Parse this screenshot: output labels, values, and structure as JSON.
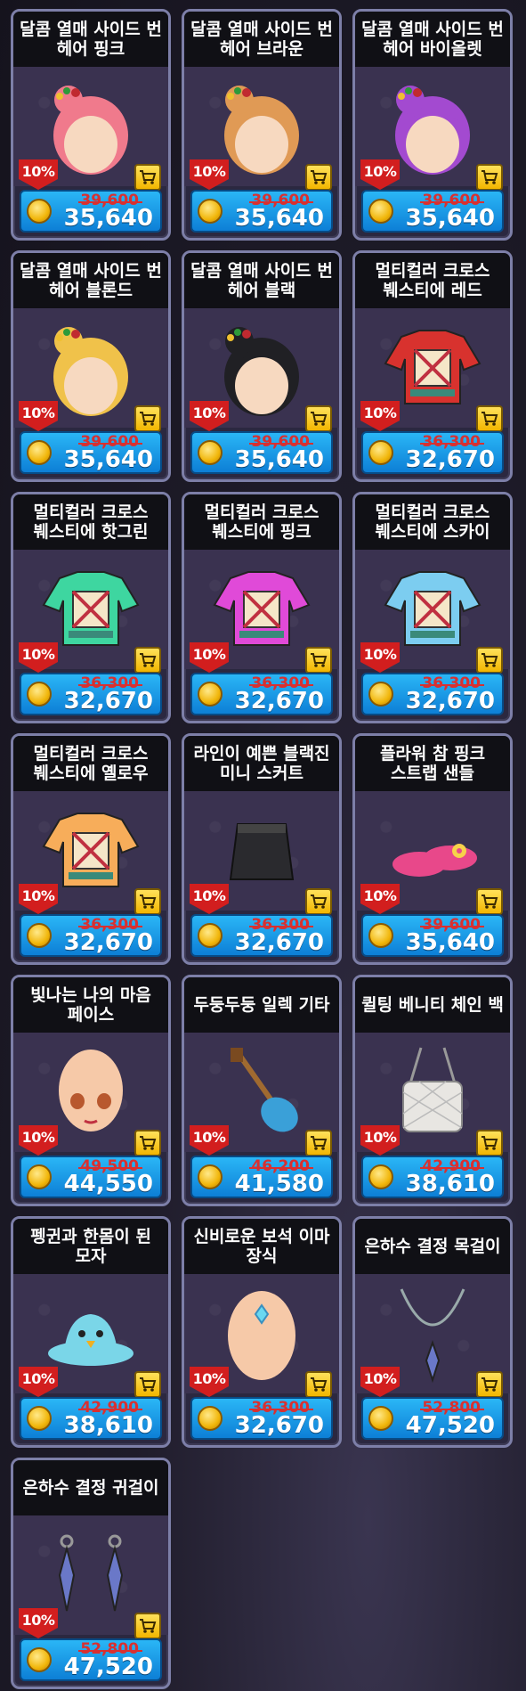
{
  "items": [
    {
      "name": "달콤 열매 사이드 번\n헤어 핑크",
      "discount": "10%",
      "old_price": "39,600",
      "price": "35,640",
      "icon": "hair-icon",
      "color": "#f07a8c"
    },
    {
      "name": "달콤 열매 사이드 번\n헤어 브라운",
      "discount": "10%",
      "old_price": "39,600",
      "price": "35,640",
      "icon": "hair-icon",
      "color": "#e09a55"
    },
    {
      "name": "달콤 열매 사이드 번\n헤어 바이올렛",
      "discount": "10%",
      "old_price": "39,600",
      "price": "35,640",
      "icon": "hair-icon",
      "color": "#a34ad0"
    },
    {
      "name": "달콤 열매 사이드 번\n헤어 블론드",
      "discount": "10%",
      "old_price": "39,600",
      "price": "35,640",
      "icon": "hair-icon",
      "color": "#f0c24a"
    },
    {
      "name": "달콤 열매 사이드 번\n헤어 블랙",
      "discount": "10%",
      "old_price": "39,600",
      "price": "35,640",
      "icon": "hair-icon",
      "color": "#202024"
    },
    {
      "name": "멀티컬러 크로스\n붸스티에 레드",
      "discount": "10%",
      "old_price": "36,300",
      "price": "32,670",
      "icon": "shirt-icon",
      "color": "#d8322e"
    },
    {
      "name": "멀티컬러 크로스\n붸스티에 핫그린",
      "discount": "10%",
      "old_price": "36,300",
      "price": "32,670",
      "icon": "shirt-icon",
      "color": "#3ed6a0"
    },
    {
      "name": "멀티컬러 크로스\n붸스티에 핑크",
      "discount": "10%",
      "old_price": "36,300",
      "price": "32,670",
      "icon": "shirt-icon",
      "color": "#e04ad8"
    },
    {
      "name": "멀티컬러 크로스\n붸스티에 스카이",
      "discount": "10%",
      "old_price": "36,300",
      "price": "32,670",
      "icon": "shirt-icon",
      "color": "#7ccdf0"
    },
    {
      "name": "멀티컬러 크로스\n붸스티에 옐로우",
      "discount": "10%",
      "old_price": "36,300",
      "price": "32,670",
      "icon": "shirt-icon",
      "color": "#f7ad5a"
    },
    {
      "name": "라인이 예쁜 블랙진\n미니 스커트",
      "discount": "10%",
      "old_price": "36,300",
      "price": "32,670",
      "icon": "skirt-icon",
      "color": "#2a2a2e"
    },
    {
      "name": "플라워 참 핑크\n스트랩 샌들",
      "discount": "10%",
      "old_price": "39,600",
      "price": "35,640",
      "icon": "sandal-icon",
      "color": "#e8488a"
    },
    {
      "name": "빛나는 나의 마음\n페이스",
      "discount": "10%",
      "old_price": "49,500",
      "price": "44,550",
      "icon": "face-icon",
      "color": "#f6c9a8"
    },
    {
      "name": "두둥두둥 일렉 기타",
      "discount": "10%",
      "old_price": "46,200",
      "price": "41,580",
      "icon": "guitar-icon",
      "color": "#3aa0d8"
    },
    {
      "name": "퀼팅 베니티 체인 백",
      "discount": "10%",
      "old_price": "42,900",
      "price": "38,610",
      "icon": "bag-icon",
      "color": "#e8e6e2"
    },
    {
      "name": "펭귄과 한몸이 된\n모자",
      "discount": "10%",
      "old_price": "42,900",
      "price": "38,610",
      "icon": "hat-icon",
      "color": "#7ad6e8"
    },
    {
      "name": "신비로운 보석 이마\n장식",
      "discount": "10%",
      "old_price": "36,300",
      "price": "32,670",
      "icon": "forehead-gem-icon",
      "color": "#f6c9a8"
    },
    {
      "name": "은하수 결정 목걸이",
      "discount": "10%",
      "old_price": "52,800",
      "price": "47,520",
      "icon": "necklace-icon",
      "color": "#6a78c8"
    },
    {
      "name": "은하수 결정 귀걸이",
      "discount": "10%",
      "old_price": "52,800",
      "price": "47,520",
      "icon": "earring-icon",
      "color": "#6a78c8"
    }
  ]
}
